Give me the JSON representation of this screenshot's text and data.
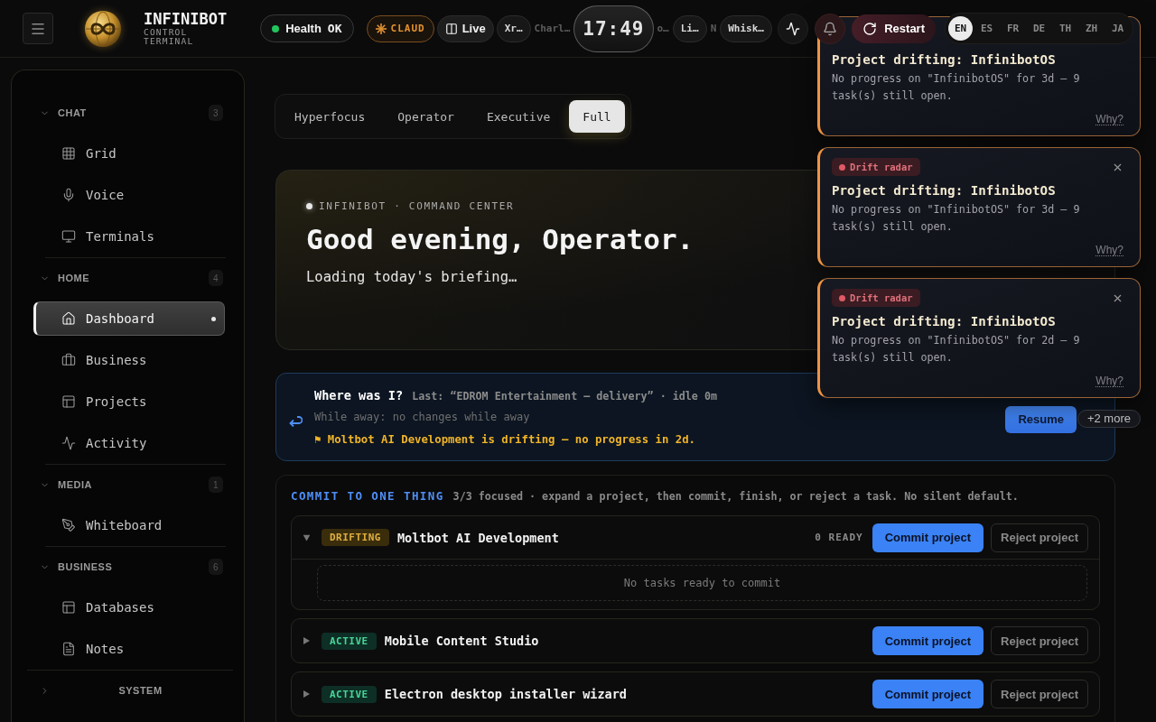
{
  "header": {
    "brand": {
      "title": "INFINIBOT",
      "subtitle": "CONTROL TERMINAL"
    },
    "health": {
      "label": "Health",
      "value": "OK",
      "ok": true
    },
    "chips": [
      {
        "kind": "provider",
        "label": "CLAUD"
      },
      {
        "kind": "live",
        "label": "Live"
      },
      {
        "kind": "agent",
        "label": "Xr…"
      },
      {
        "kind": "faded",
        "label": "Charl…"
      },
      {
        "kind": "clock",
        "label": "17:49"
      },
      {
        "kind": "faded",
        "label": "o…"
      },
      {
        "kind": "agent",
        "label": "Li…"
      },
      {
        "kind": "faded",
        "label": "N"
      },
      {
        "kind": "agent",
        "label": "Whisk…"
      }
    ],
    "restart": "Restart",
    "languages": [
      {
        "code": "EN",
        "selected": true
      },
      {
        "code": "ES",
        "selected": false
      },
      {
        "code": "FR",
        "selected": false
      },
      {
        "code": "DE",
        "selected": false
      },
      {
        "code": "TH",
        "selected": false
      },
      {
        "code": "ZH",
        "selected": false
      },
      {
        "code": "JA",
        "selected": false
      }
    ]
  },
  "sidebar": {
    "groups": [
      {
        "label": "CHAT",
        "count": "3",
        "expanded": true,
        "items": [
          {
            "label": "Grid",
            "selected": false
          },
          {
            "label": "Voice",
            "selected": false
          },
          {
            "label": "Terminals",
            "selected": false
          }
        ]
      },
      {
        "label": "HOME",
        "count": "4",
        "expanded": true,
        "items": [
          {
            "label": "Dashboard",
            "selected": true
          },
          {
            "label": "Business",
            "selected": false
          },
          {
            "label": "Projects",
            "selected": false
          },
          {
            "label": "Activity",
            "selected": false
          }
        ]
      },
      {
        "label": "MEDIA",
        "count": "1",
        "expanded": true,
        "items": [
          {
            "label": "Whiteboard",
            "selected": false
          }
        ]
      },
      {
        "label": "BUSINESS",
        "count": "6",
        "expanded": true,
        "items": [
          {
            "label": "Databases",
            "selected": false
          },
          {
            "label": "Notes",
            "selected": false
          }
        ]
      },
      {
        "label": "SYSTEM",
        "expanded": false
      }
    ]
  },
  "view_tabs": [
    {
      "label": "Hyperfocus",
      "selected": false
    },
    {
      "label": "Operator",
      "selected": false
    },
    {
      "label": "Executive",
      "selected": false
    },
    {
      "label": "Full",
      "selected": true
    }
  ],
  "hero": {
    "eyebrow": "INFINIBOT · COMMAND CENTER",
    "greeting": "Good evening, Operator.",
    "status": "Loading today's briefing…"
  },
  "resume_card": {
    "title": "Where was I?",
    "last": "Last: “EDROM Entertainment — delivery” · idle 0m",
    "away": "While away: no changes while away",
    "alert": "⚑ Moltbot AI Development is drifting — no progress in 2d.",
    "button": "Resume"
  },
  "commit": {
    "title": "COMMIT TO ONE THING",
    "subtitle": "3/3 focused · expand a project, then commit, finish, or reject a task. No silent default.",
    "projects": [
      {
        "kind": "drifting",
        "status": "DRIFTING",
        "name": "Moltbot AI Development",
        "expanded": true,
        "ready": "0 READY",
        "empty": "No tasks ready to commit",
        "commit": "Commit project",
        "reject": "Reject project"
      },
      {
        "kind": "active",
        "status": "ACTIVE",
        "name": "Mobile Content Studio",
        "expanded": false,
        "commit": "Commit project",
        "reject": "Reject project"
      },
      {
        "kind": "active",
        "status": "ACTIVE",
        "name": "Electron desktop installer wizard",
        "expanded": false,
        "commit": "Commit project",
        "reject": "Reject project"
      }
    ]
  },
  "notifications": {
    "items": [
      {
        "closable": false,
        "title": "Project drifting: InfinibotOS",
        "body": "No progress on \"InfinibotOS\" for 3d — 9 task(s) still open.",
        "why": "Why?"
      },
      {
        "badge": "Drift radar",
        "closable": true,
        "title": "Project drifting: InfinibotOS",
        "body": "No progress on \"InfinibotOS\" for 3d — 9 task(s) still open.",
        "why": "Why?"
      },
      {
        "badge": "Drift radar",
        "closable": true,
        "title": "Project drifting: InfinibotOS",
        "body": "No progress on \"InfinibotOS\" for 2d — 9 task(s) still open.",
        "why": "Why?"
      }
    ],
    "more": "+2 more"
  }
}
